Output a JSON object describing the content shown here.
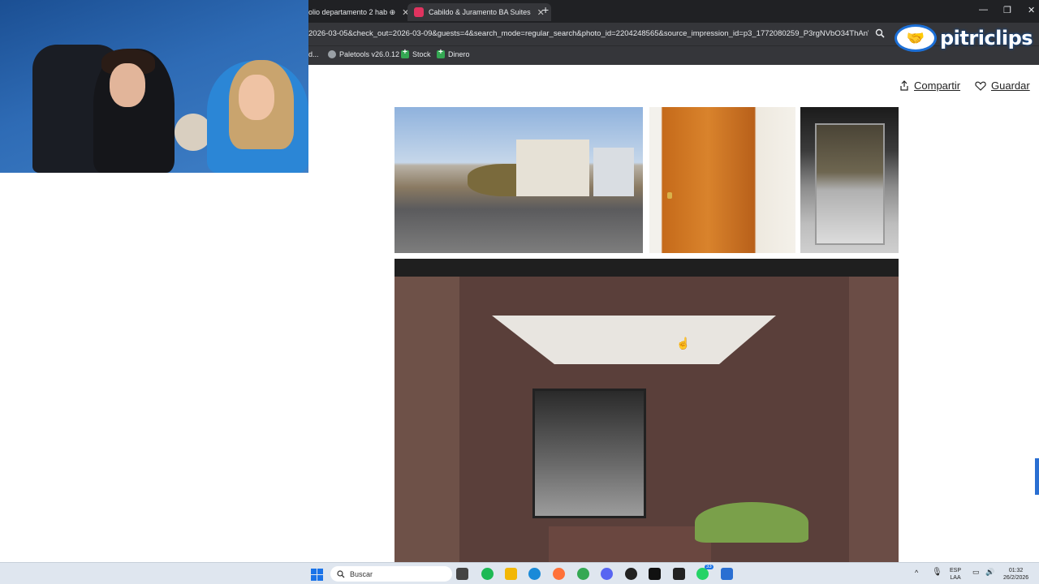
{
  "browser": {
    "tabs": [
      {
        "label": "olio departamento 2 hab ⊕",
        "active": false
      },
      {
        "label": "Cabildo & Juramento BA Suites",
        "active": true
      }
    ],
    "url": "2026-03-05&check_out=2026-03-09&guests=4&search_mode=regular_search&photo_id=2204248565&source_impression_id=p3_1772080259_P3rgNVbO34ThAnV...",
    "bookmarks": [
      {
        "label": "d...",
        "icon": "truncated"
      },
      {
        "label": "Paletools v26.0.12",
        "icon": "globe-icon"
      },
      {
        "label": "Stock",
        "icon": "sheets-icon"
      },
      {
        "label": "Dinero",
        "icon": "sheets-icon"
      }
    ]
  },
  "page": {
    "share_label": "Compartir",
    "save_label": "Guardar"
  },
  "watermark": {
    "text": "pitriclips"
  },
  "taskbar": {
    "search_placeholder": "Buscar",
    "lang_top": "ESP",
    "lang_bottom": "LAA",
    "time": "01:32",
    "date": "26/2/2026",
    "badge_count": "33"
  },
  "colors": {
    "accent": "#1c6fd6",
    "chrome_dark": "#202124",
    "chrome_mid": "#35363a"
  }
}
